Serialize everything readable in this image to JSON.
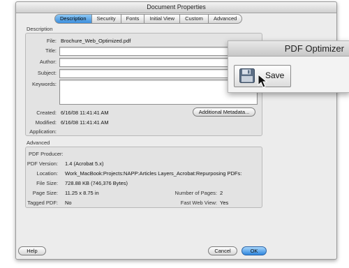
{
  "window": {
    "title": "Document Properties"
  },
  "tabs": [
    {
      "label": "Description",
      "active": true
    },
    {
      "label": "Security"
    },
    {
      "label": "Fonts"
    },
    {
      "label": "Initial View"
    },
    {
      "label": "Custom"
    },
    {
      "label": "Advanced"
    }
  ],
  "description": {
    "section_label": "Description",
    "file_label": "File:",
    "file_value": "Brochure_Web_Optimized.pdf",
    "title_label": "Title:",
    "title_value": "",
    "author_label": "Author:",
    "author_value": "",
    "subject_label": "Subject:",
    "subject_value": "",
    "keywords_label": "Keywords:",
    "keywords_value": "",
    "created_label": "Created:",
    "created_value": "6/16/08 11:41:41 AM",
    "modified_label": "Modified:",
    "modified_value": "6/16/08 11:41:41 AM",
    "application_label": "Application:",
    "application_value": "",
    "additional_metadata_button": "Additional Metadata..."
  },
  "advanced": {
    "section_label": "Advanced",
    "pdf_producer_label": "PDF Producer:",
    "pdf_producer_value": "",
    "pdf_version_label": "PDF Version:",
    "pdf_version_value": "1.4 (Acrobat 5.x)",
    "location_label": "Location:",
    "location_value": "Work_MacBook:Projects:NAPP:Articles Layers_Acrobat:Repurposing PDFs:",
    "file_size_label": "File Size:",
    "file_size_value": "728.88 KB (746,376 Bytes)",
    "page_size_label": "Page Size:",
    "page_size_value": "11.25 x 8.75 in",
    "number_of_pages_label": "Number of Pages:",
    "number_of_pages_value": "2",
    "tagged_pdf_label": "Tagged PDF:",
    "tagged_pdf_value": "No",
    "fast_web_view_label": "Fast Web View:",
    "fast_web_view_value": "Yes"
  },
  "footer": {
    "help": "Help",
    "cancel": "Cancel",
    "ok": "OK"
  },
  "optimizer": {
    "title": "PDF Optimizer",
    "save_label": "Save",
    "save_icon": "floppy-disk-icon",
    "cursor_icon": "mouse-pointer-icon"
  },
  "colors": {
    "tab_active": "#3c8fde",
    "ok_button": "#2f86dd"
  }
}
